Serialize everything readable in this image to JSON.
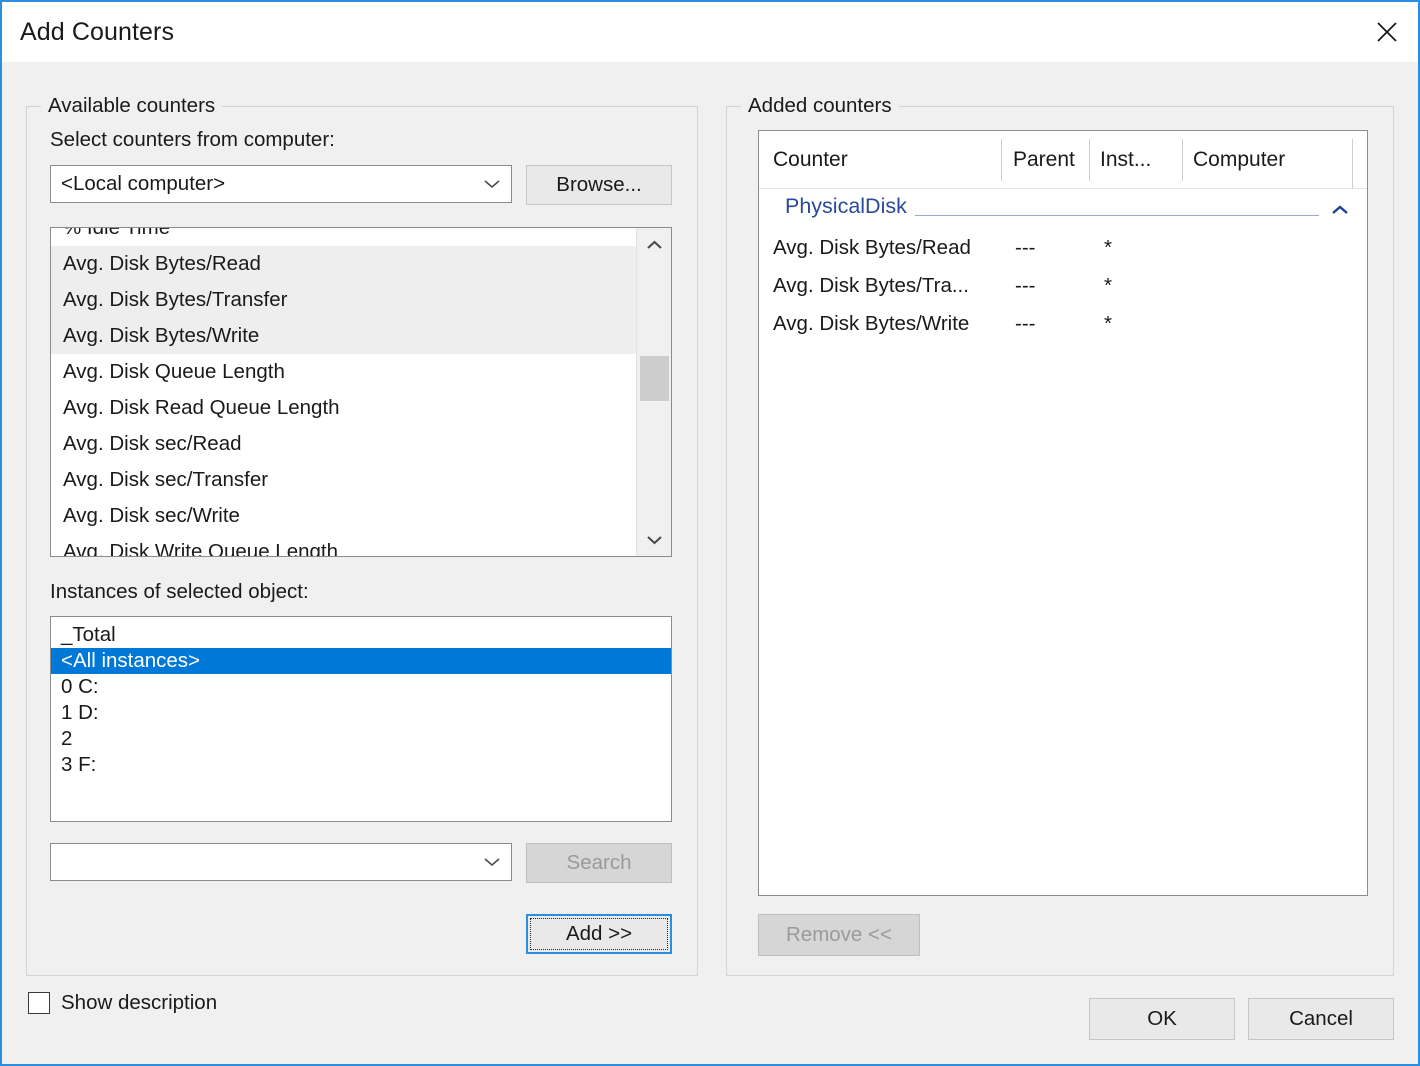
{
  "window": {
    "title": "Add Counters",
    "close_icon": "close-icon",
    "border_color": "#2a8fe0"
  },
  "available": {
    "group_label": "Available counters",
    "computer_label": "Select counters from computer:",
    "computer_combo_value": "<Local computer>",
    "computer_combo_placeholder": "",
    "browse_label": "Browse...",
    "counters": [
      {
        "label": "% Idle Time",
        "selected": false,
        "clipped": true
      },
      {
        "label": "Avg. Disk Bytes/Read",
        "selected": true
      },
      {
        "label": "Avg. Disk Bytes/Transfer",
        "selected": true
      },
      {
        "label": "Avg. Disk Bytes/Write",
        "selected": true
      },
      {
        "label": "Avg. Disk Queue Length",
        "selected": false
      },
      {
        "label": "Avg. Disk Read Queue Length",
        "selected": false
      },
      {
        "label": "Avg. Disk sec/Read",
        "selected": false
      },
      {
        "label": "Avg. Disk sec/Transfer",
        "selected": false
      },
      {
        "label": "Avg. Disk sec/Write",
        "selected": false
      },
      {
        "label": "Avg. Disk Write Queue Length",
        "selected": false,
        "clipped": true
      }
    ],
    "instances_label": "Instances of selected object:",
    "instances": [
      {
        "label": "_Total",
        "selected": false
      },
      {
        "label": "<All instances>",
        "selected": true
      },
      {
        "label": "0 C:",
        "selected": false
      },
      {
        "label": "1 D:",
        "selected": false
      },
      {
        "label": "2",
        "selected": false
      },
      {
        "label": "3 F:",
        "selected": false
      }
    ],
    "search_combo_value": "",
    "search_combo_placeholder": "",
    "search_label": "Search",
    "search_enabled": false,
    "add_label": "Add >>",
    "add_focused": true
  },
  "added": {
    "group_label": "Added counters",
    "columns": [
      "Counter",
      "Parent",
      "Inst...",
      "Computer"
    ],
    "groups": [
      {
        "name": "PhysicalDisk",
        "collapsed": false,
        "chevron_icon": "chevron-up-icon",
        "rows": [
          {
            "counter": "Avg. Disk Bytes/Read",
            "parent": "---",
            "instance": "*",
            "computer": ""
          },
          {
            "counter": "Avg. Disk Bytes/Tra...",
            "parent": "---",
            "instance": "*",
            "computer": ""
          },
          {
            "counter": "Avg. Disk Bytes/Write",
            "parent": "---",
            "instance": "*",
            "computer": ""
          }
        ]
      }
    ],
    "remove_label": "Remove <<",
    "remove_enabled": false,
    "group_color": "#2b4a9b"
  },
  "footer": {
    "show_description_label": "Show description",
    "show_description_checked": false,
    "ok_label": "OK",
    "cancel_label": "Cancel"
  }
}
